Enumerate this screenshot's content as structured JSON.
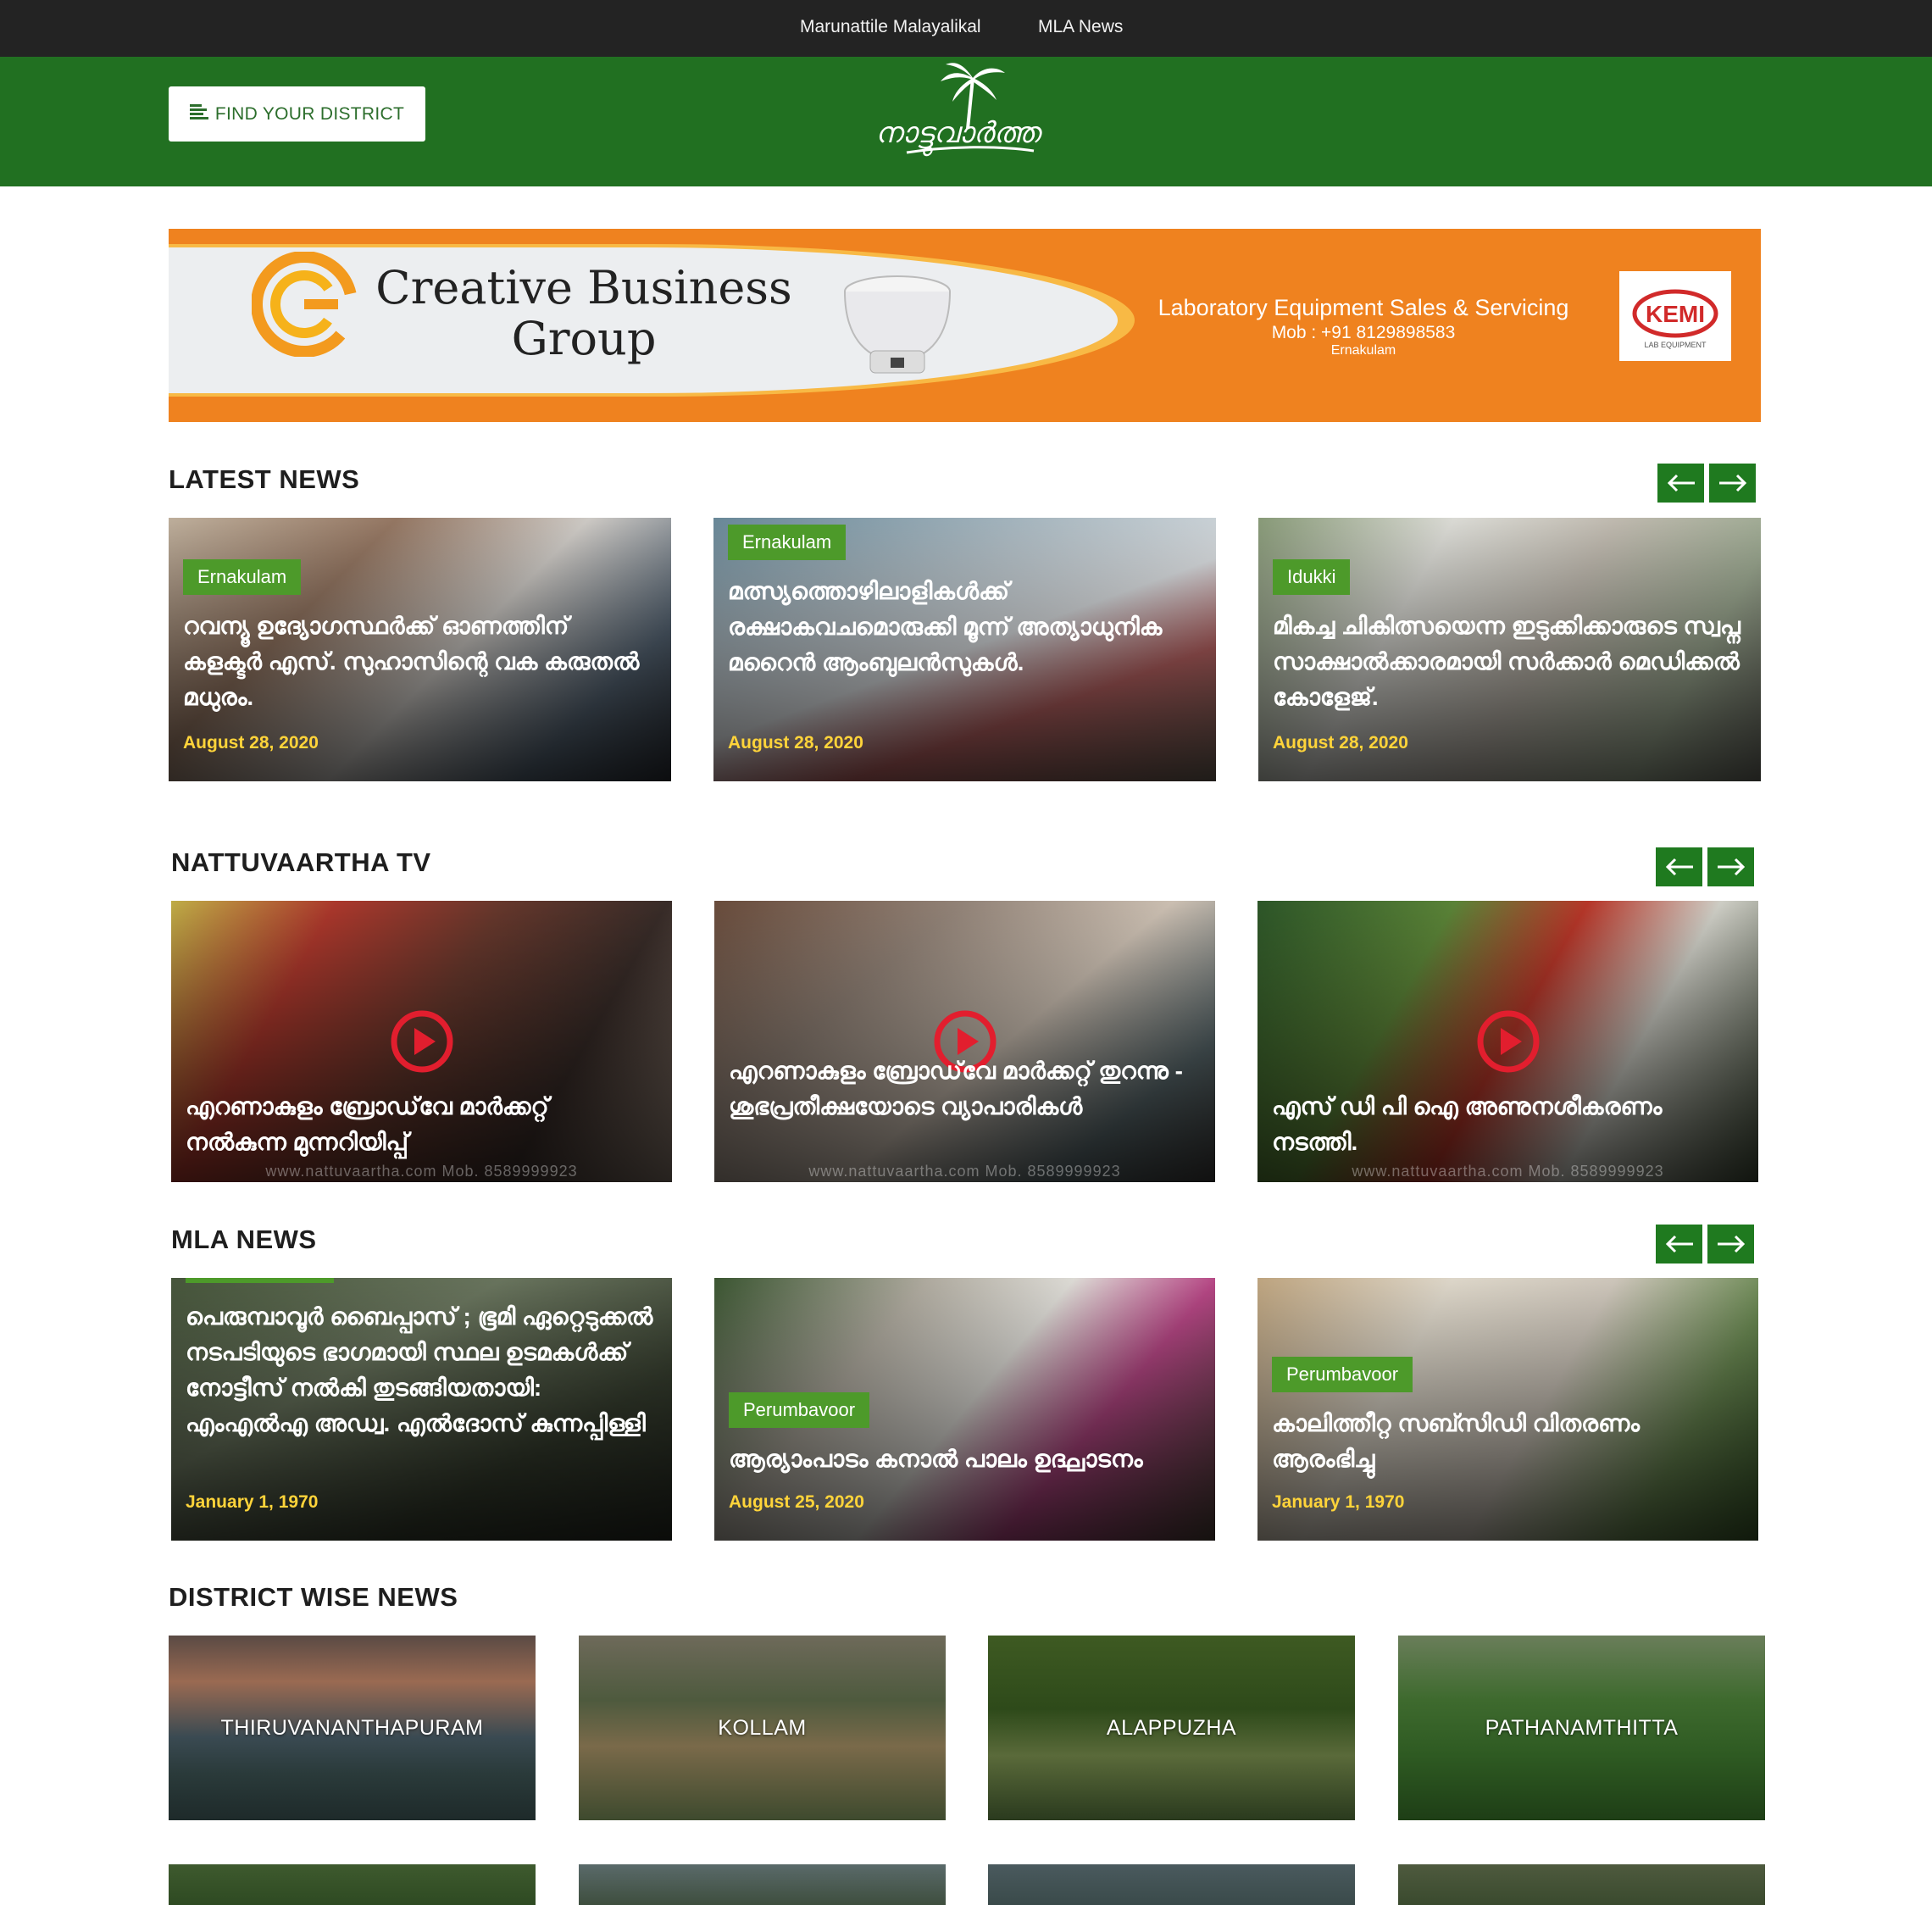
{
  "topnav": {
    "items": [
      "Marunattile Malayalikal",
      "MLA News"
    ]
  },
  "header": {
    "find_district": "FIND YOUR DISTRICT",
    "logo_text": "നാട്ടുവാർത്ത"
  },
  "banner": {
    "company": "Creative Business Group",
    "company_line1": "Creative Business",
    "company_line2": "Group",
    "service": "Laboratory Equipment Sales & Servicing",
    "mobile": "Mob : +91 8129898583",
    "location": "Ernakulam",
    "brand": "KEMI",
    "brand_sub": "LAB EQUIPMENT",
    "colors": {
      "orange": "#ef821f",
      "yellow": "#f8b945"
    }
  },
  "latest_news": {
    "title": "LATEST NEWS",
    "cards": [
      {
        "tag": "Ernakulam",
        "headline": "റവന്യൂ ഉദ്യോഗസ്ഥർക്ക് ഓണത്തിന് കളക്ടർ എസ്. സുഹാസിന്റെ വക കരുതൽ മധുരം.",
        "date": "August 28, 2020"
      },
      {
        "tag": "Ernakulam",
        "headline": "മത്സ്യത്തൊഴിലാളികൾക്ക് രക്ഷാകവചമൊരുക്കി മൂന്ന് അത്യാധുനിക മറൈൻ ആംബുലൻസുകൾ.",
        "date": "August 28, 2020"
      },
      {
        "tag": "Idukki",
        "headline": "മികച്ച ചികിത്സയെന്ന ഇടുക്കിക്കാരുടെ സ്വപ്ന സാക്ഷാൽക്കാരമായി സർക്കാർ മെഡിക്കൽ കോളേജ്.",
        "date": "August 28, 2020"
      }
    ]
  },
  "tv": {
    "title": "NATTUVAARTHA TV",
    "watermark": "www.nattuvaartha.com Mob. 8589999923",
    "cards": [
      {
        "headline": "എറണാകുളം ബ്രോഡ്‌വേ മാർക്കറ്റ് നൽകുന്ന മുന്നറിയിപ്പ്"
      },
      {
        "headline": "എറണാകുളം ബ്രോഡ്‌വേ മാർക്കറ്റ് തുറന്നു - ശുഭപ്രതീക്ഷയോടെ വ്യാപാരികൾ"
      },
      {
        "headline": "എസ് ഡി പി ഐ അണുനശീകരണം നടത്തി."
      }
    ]
  },
  "mla_news": {
    "title": "MLA NEWS",
    "cards": [
      {
        "tag": "",
        "headline": "പെരുമ്പാവൂർ ബൈപ്പാസ് ; ഭൂമി ഏറ്റെടുക്കൽ നടപടിയുടെ ഭാഗമായി സ്ഥല ഉടമകൾക്ക് നോട്ടീസ് നൽകി തുടങ്ങിയതായി: എംഎൽഎ അഡ്വ. എൽദോസ് കുന്നപ്പിള്ളി",
        "date": "January 1, 1970"
      },
      {
        "tag": "Perumbavoor",
        "headline": "ആര്യാംപാടം കനാൽ പാലം ഉദ്ഘാടനം",
        "date": "August 25, 2020"
      },
      {
        "tag": "Perumbavoor",
        "headline": "കാലിത്തീറ്റ സബ്സിഡി വിതരണം ആരംഭിച്ചു",
        "date": "January 1, 1970"
      }
    ]
  },
  "districts": {
    "title": "DISTRICT WISE NEWS",
    "items": [
      "THIRUVANANTHAPURAM",
      "KOLLAM",
      "ALAPPUZHA",
      "PATHANAMTHITTA"
    ]
  }
}
